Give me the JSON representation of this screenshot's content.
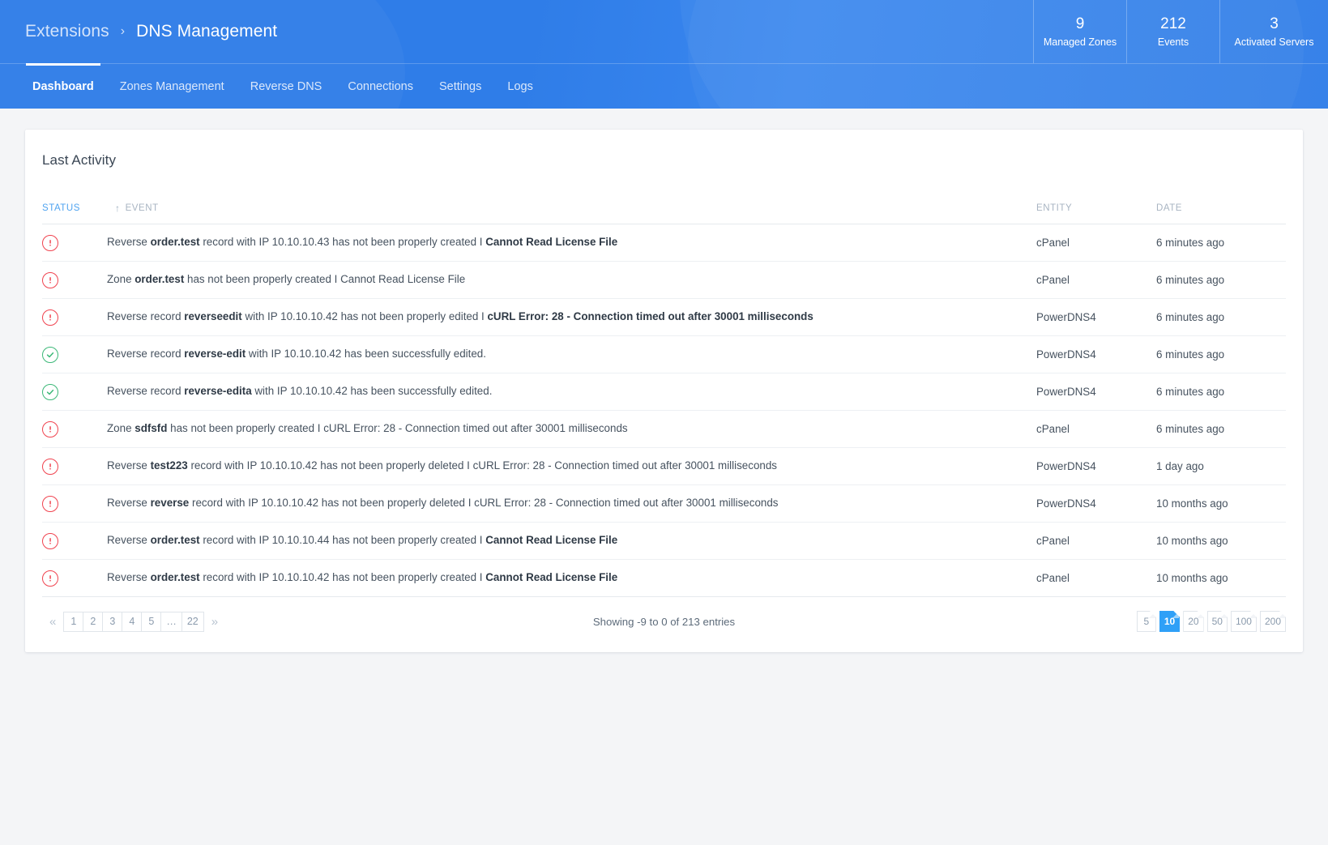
{
  "header": {
    "breadcrumb_parent": "Extensions",
    "breadcrumb_separator": "›",
    "breadcrumb_current": "DNS Management",
    "stats": [
      {
        "value": "9",
        "label": "Managed Zones"
      },
      {
        "value": "212",
        "label": "Events"
      },
      {
        "value": "3",
        "label": "Activated Servers"
      }
    ],
    "tabs": [
      {
        "label": "Dashboard",
        "active": true
      },
      {
        "label": "Zones Management",
        "active": false
      },
      {
        "label": "Reverse DNS",
        "active": false
      },
      {
        "label": "Connections",
        "active": false
      },
      {
        "label": "Settings",
        "active": false
      },
      {
        "label": "Logs",
        "active": false
      }
    ]
  },
  "card": {
    "title": "Last Activity",
    "columns": {
      "status": "STATUS",
      "event": "EVENT",
      "entity": "ENTITY",
      "date": "DATE"
    },
    "sort": {
      "column": "STATUS",
      "direction": "asc",
      "arrow": "↑"
    },
    "rows": [
      {
        "status": "error",
        "event_prefix": "Reverse ",
        "event_target": "order.test",
        "event_middle": " record with IP 10.10.10.43 has not been properly created I ",
        "event_detail": "Cannot Read License File",
        "detail_bold": true,
        "entity": "cPanel",
        "date": "6 minutes ago"
      },
      {
        "status": "error",
        "event_prefix": "Zone ",
        "event_target": "order.test",
        "event_middle": " has not been properly created I Cannot Read License File",
        "event_detail": "",
        "detail_bold": false,
        "entity": "cPanel",
        "date": "6 minutes ago"
      },
      {
        "status": "error",
        "event_prefix": "Reverse record ",
        "event_target": "reverseedit",
        "event_middle": " with IP 10.10.10.42 has not been properly edited I ",
        "event_detail": "cURL Error: 28 - Connection timed out after 30001 milliseconds",
        "detail_bold": true,
        "entity": "PowerDNS4",
        "date": "6 minutes ago"
      },
      {
        "status": "ok",
        "event_prefix": "Reverse record ",
        "event_target": "reverse-edit",
        "event_middle": " with IP 10.10.10.42 has been successfully edited.",
        "event_detail": "",
        "detail_bold": false,
        "entity": "PowerDNS4",
        "date": "6 minutes ago"
      },
      {
        "status": "ok",
        "event_prefix": "Reverse record ",
        "event_target": "reverse-edita",
        "event_middle": " with IP 10.10.10.42 has been successfully edited.",
        "event_detail": "",
        "detail_bold": false,
        "entity": "PowerDNS4",
        "date": "6 minutes ago"
      },
      {
        "status": "error",
        "event_prefix": "Zone ",
        "event_target": "sdfsfd",
        "event_middle": " has not been properly created I cURL Error: 28 - Connection timed out after 30001 milliseconds",
        "event_detail": "",
        "detail_bold": false,
        "entity": "cPanel",
        "date": "6 minutes ago"
      },
      {
        "status": "error",
        "event_prefix": "Reverse ",
        "event_target": "test223",
        "event_middle": " record with IP 10.10.10.42 has not been properly deleted I cURL Error: 28 - Connection timed out after 30001 milliseconds",
        "event_detail": "",
        "detail_bold": false,
        "entity": "PowerDNS4",
        "date": "1 day ago"
      },
      {
        "status": "error",
        "event_prefix": "Reverse ",
        "event_target": "reverse",
        "event_middle": " record with IP 10.10.10.42 has not been properly deleted I cURL Error: 28 - Connection timed out after 30001 milliseconds",
        "event_detail": "",
        "detail_bold": false,
        "entity": "PowerDNS4",
        "date": "10 months ago"
      },
      {
        "status": "error",
        "event_prefix": "Reverse ",
        "event_target": "order.test",
        "event_middle": " record with IP 10.10.10.44 has not been properly created I ",
        "event_detail": "Cannot Read License File",
        "detail_bold": true,
        "entity": "cPanel",
        "date": "10 months ago"
      },
      {
        "status": "error",
        "event_prefix": "Reverse ",
        "event_target": "order.test",
        "event_middle": " record with IP 10.10.10.42 has not been properly created I ",
        "event_detail": "Cannot Read License File",
        "detail_bold": true,
        "entity": "cPanel",
        "date": "10 months ago"
      }
    ]
  },
  "pagination": {
    "prev_label": "«",
    "next_label": "»",
    "pages": [
      "1",
      "2",
      "3",
      "4",
      "5",
      "…",
      "22"
    ],
    "current_page": "1",
    "showing_text": "Showing -9 to 0 of 213 entries",
    "page_sizes": [
      "5",
      "10",
      "20",
      "50",
      "100",
      "200"
    ],
    "active_page_size": "10"
  },
  "colors": {
    "brand_blue": "#2f7de8",
    "accent_blue": "#2fa0f7",
    "error_red": "#f0434f",
    "success_green": "#3cb878",
    "sorted_header": "#4fa3f0"
  }
}
